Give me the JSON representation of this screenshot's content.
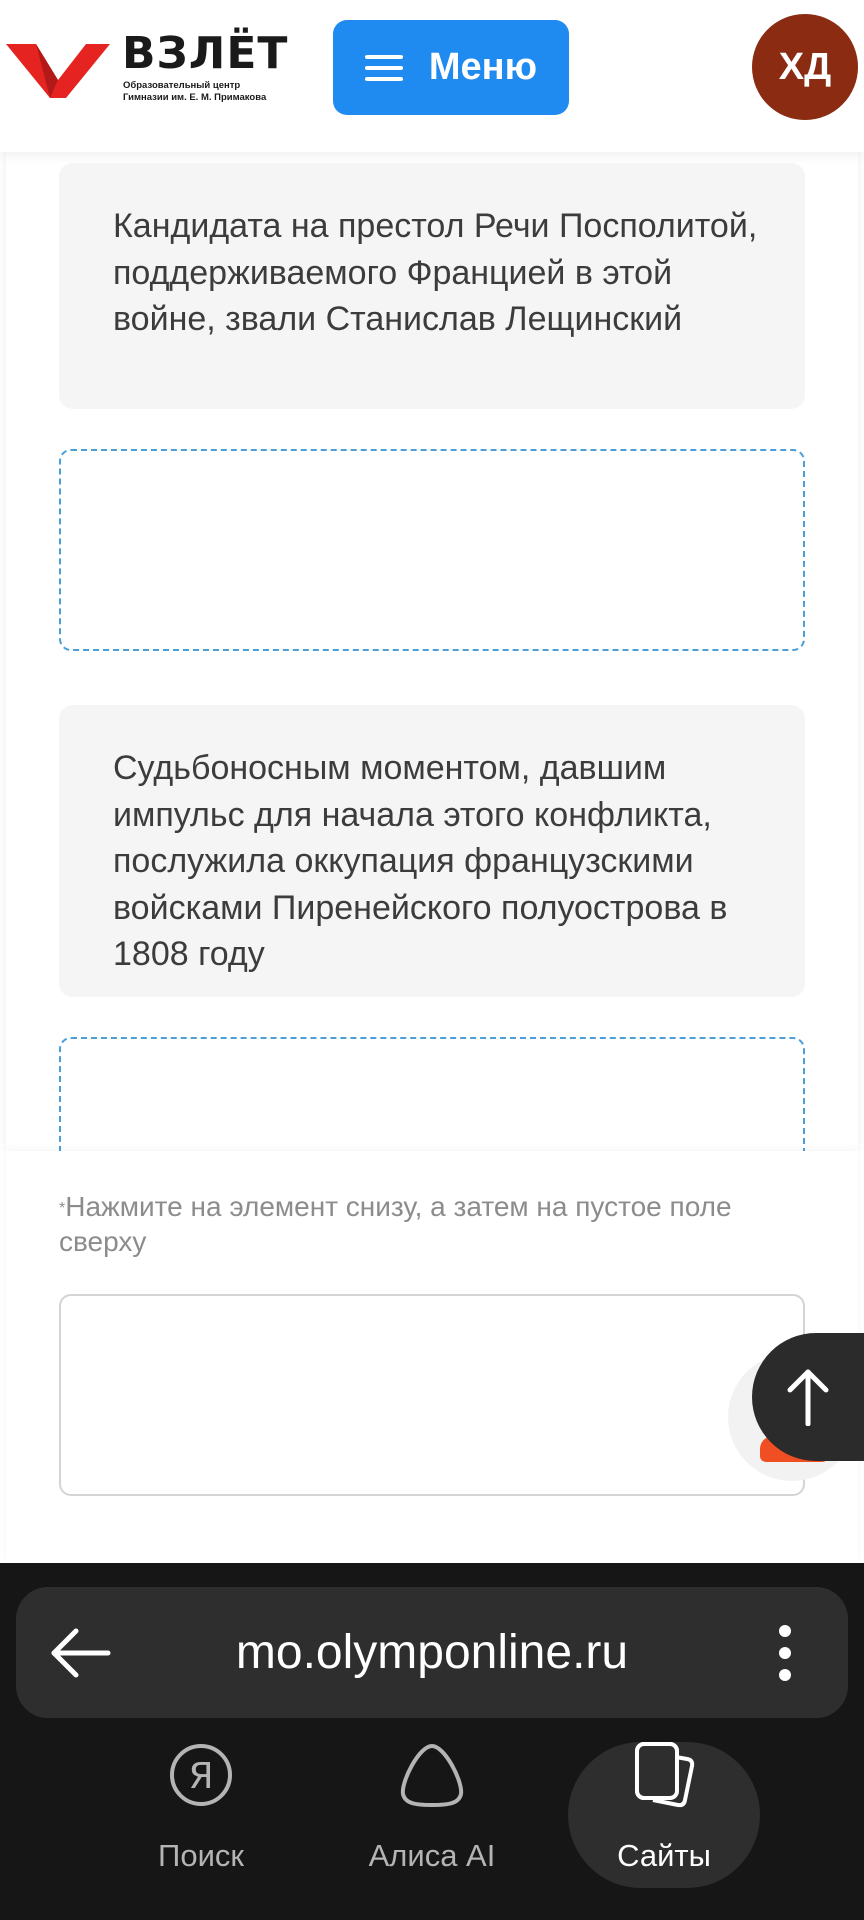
{
  "header": {
    "logo": {
      "title": "ВЗЛЁТ",
      "subtitle_line1": "Образовательный центр",
      "subtitle_line2": "Гимназии им. Е. М. Примакова",
      "brand_color": "#e52421"
    },
    "menu_button": {
      "label": "Меню",
      "icon": "hamburger-icon",
      "color": "#1f8af0"
    },
    "avatar": {
      "initials": "ХД",
      "color": "#8a2b12"
    }
  },
  "task": {
    "statements": [
      {
        "text": "Кандидата на престол Речи Посполитой, поддерживаемого Францией в этой войне, звали Станислав Лещинский"
      },
      {
        "text": "Судьбоносным моментом, давшим импульс для начала этого конфликта, послужила оккупация французскими войсками Пиренейского полуострова в 1808 году"
      }
    ],
    "hint": {
      "marker": "*",
      "text": "Нажмите на элемент снизу, а затем на пустое поле сверху"
    },
    "accent_dash_color": "#4a9fd8"
  },
  "floating": {
    "scroll_top_icon": "arrow-up-icon"
  },
  "browser": {
    "url": "mo.olymponline.ru",
    "back_icon": "arrow-left-icon",
    "more_icon": "kebab-icon",
    "nav": [
      {
        "label": "Поиск",
        "icon": "yandex-icon"
      },
      {
        "label": "Алиса AI",
        "icon": "alice-icon"
      },
      {
        "label": "Сайты",
        "icon": "sites-icon",
        "active": true
      }
    ]
  }
}
